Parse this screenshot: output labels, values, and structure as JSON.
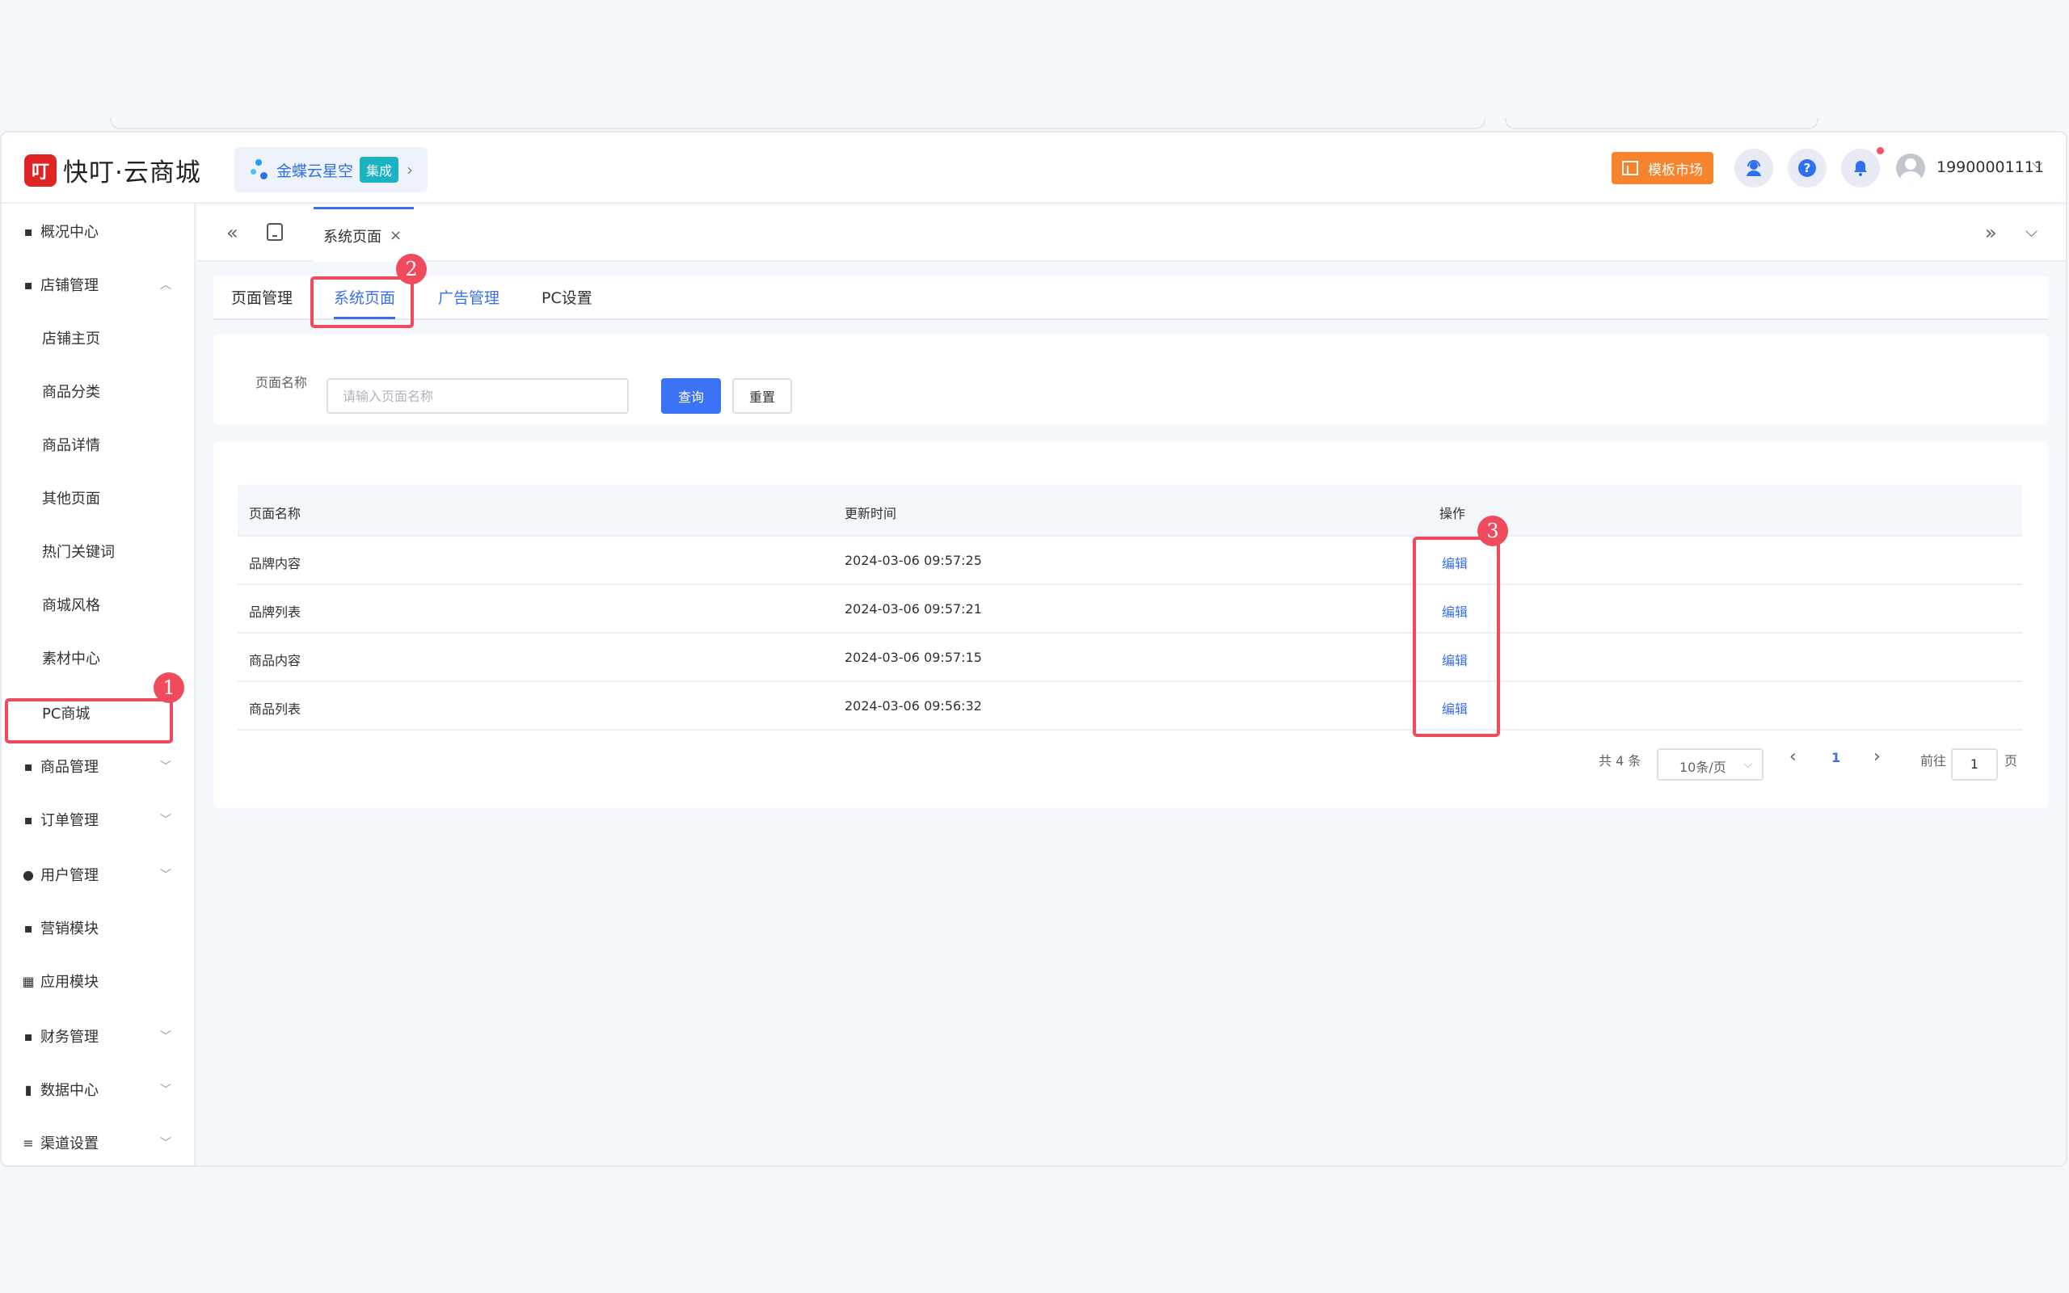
{
  "brand": {
    "name": "快叮·云商城",
    "logo_glyph": "叮",
    "accent": "#e02424"
  },
  "integration": {
    "label": "金蝶云星空",
    "badge": "集成",
    "chevron": "›"
  },
  "header": {
    "template_market_label": "模板市场",
    "service_icon": "customer-service-icon",
    "help_glyph": "?",
    "bell_icon": "bell-icon",
    "user_phone": "19900001111",
    "user_caret": "⌵"
  },
  "sidebar": {
    "items": [
      {
        "label": "概况中心",
        "icon": "▪",
        "caret": ""
      },
      {
        "label": "店铺管理",
        "icon": "▪",
        "caret": "︿"
      },
      {
        "label": "店铺主页"
      },
      {
        "label": "商品分类"
      },
      {
        "label": "商品详情"
      },
      {
        "label": "其他页面"
      },
      {
        "label": "热门关键词"
      },
      {
        "label": "商城风格"
      },
      {
        "label": "素材中心"
      },
      {
        "label": "PC商城"
      },
      {
        "label": "商品管理",
        "icon": "▪",
        "caret": "﹀"
      },
      {
        "label": "订单管理",
        "icon": "▪",
        "caret": "﹀"
      },
      {
        "label": "用户管理",
        "icon": "●",
        "caret": "﹀"
      },
      {
        "label": "营销模块",
        "icon": "▪",
        "caret": ""
      },
      {
        "label": "应用模块",
        "icon": "▦",
        "caret": ""
      },
      {
        "label": "财务管理",
        "icon": "▪",
        "caret": "﹀"
      },
      {
        "label": "数据中心",
        "icon": "▮",
        "caret": "﹀"
      },
      {
        "label": "渠道设置",
        "icon": "≡",
        "caret": "﹀"
      }
    ]
  },
  "tabs_bar": {
    "collapse_left": "«",
    "expand_right": "»",
    "dropdown": "⌵",
    "visited_tab_label": "系统页面",
    "close": "×"
  },
  "content_tabs": [
    {
      "label": "页面管理"
    },
    {
      "label": "系统页面"
    },
    {
      "label": "广告管理"
    },
    {
      "label": "PC设置"
    }
  ],
  "search": {
    "label": "页面名称",
    "placeholder": "请输入页面名称",
    "value": "",
    "query_label": "查询",
    "reset_label": "重置"
  },
  "table": {
    "columns": [
      "页面名称",
      "更新时间",
      "操作"
    ],
    "rows": [
      {
        "name": "品牌内容",
        "updated": "2024-03-06 09:57:25",
        "action": "编辑"
      },
      {
        "name": "品牌列表",
        "updated": "2024-03-06 09:57:21",
        "action": "编辑"
      },
      {
        "name": "商品内容",
        "updated": "2024-03-06 09:57:15",
        "action": "编辑"
      },
      {
        "name": "商品列表",
        "updated": "2024-03-06 09:56:32",
        "action": "编辑"
      }
    ]
  },
  "pagination": {
    "total": "共 4 条",
    "page_size": "10条/页",
    "prev": "‹",
    "current": "1",
    "next": "›",
    "goto_prefix": "前往",
    "goto_value": "1",
    "goto_suffix": "页"
  },
  "annotations": {
    "step1": "1",
    "step2": "2",
    "step3": "3",
    "color": "#ef4b5c"
  }
}
